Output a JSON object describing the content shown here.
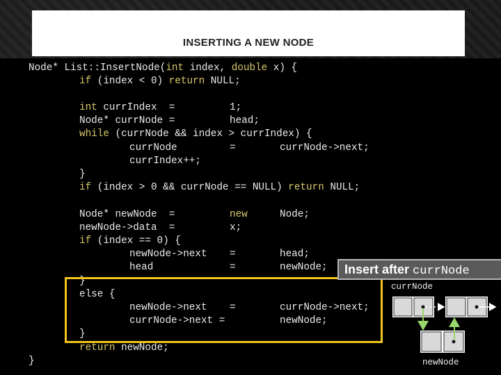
{
  "slide": {
    "title": "INSERTING A NEW NODE"
  },
  "code": {
    "signature_pre": "Node* List::InsertNode(",
    "kw_int": "int",
    "sig_index": " index, ",
    "kw_double": "double",
    "sig_x": " x) {",
    "if1_pre": "if",
    "if1_rest": " (index < 0) ",
    "kw_return": "return",
    "if1_null": " NULL;",
    "l3_kw": "int",
    "l3_a": " currIndex  =",
    "l3_b": "1;",
    "l4_a": "Node* currNode =",
    "l4_b": "head;",
    "l5_kw": "while",
    "l5_a": " (currNode && index > currIndex) {",
    "l6_a": "currNode",
    "l6_b": "=",
    "l6_c": "currNode->next;",
    "l7_a": "currIndex++;",
    "l8_a": "}",
    "l9_kw": "if",
    "l9_a": " (index > 0 && currNode == NULL) ",
    "l9_ret": "return",
    "l9_b": " NULL;",
    "l10_a": "Node* newNode  =",
    "l10_b": "new",
    "l10_c": "Node;",
    "l11_a": "newNode->data  =",
    "l11_b": "x;",
    "l12_kw": "if",
    "l12_a": " (index == 0) {",
    "l13_a": "newNode->next",
    "l13_b": "=",
    "l13_c": "head;",
    "l14_a": "head",
    "l14_b": "=",
    "l14_c": "newNode;",
    "l15_a": "}",
    "l16_a": "else {",
    "l17_a": "newNode->next",
    "l17_b": "=",
    "l17_c": "currNode->next;",
    "l18_a": "currNode->next =",
    "l18_c": "newNode;",
    "l19_a": "}",
    "l20_kw": "return",
    "l20_a": " newNode;",
    "l21_a": "}"
  },
  "callout": {
    "text": "Insert after ",
    "code": "currNode"
  },
  "diagram": {
    "curr_label": "currNode",
    "new_label": "newNode"
  },
  "colors": {
    "keyword": "#d9c96a",
    "highlight": "#f3c51e",
    "node_green": "#9ad66a"
  }
}
